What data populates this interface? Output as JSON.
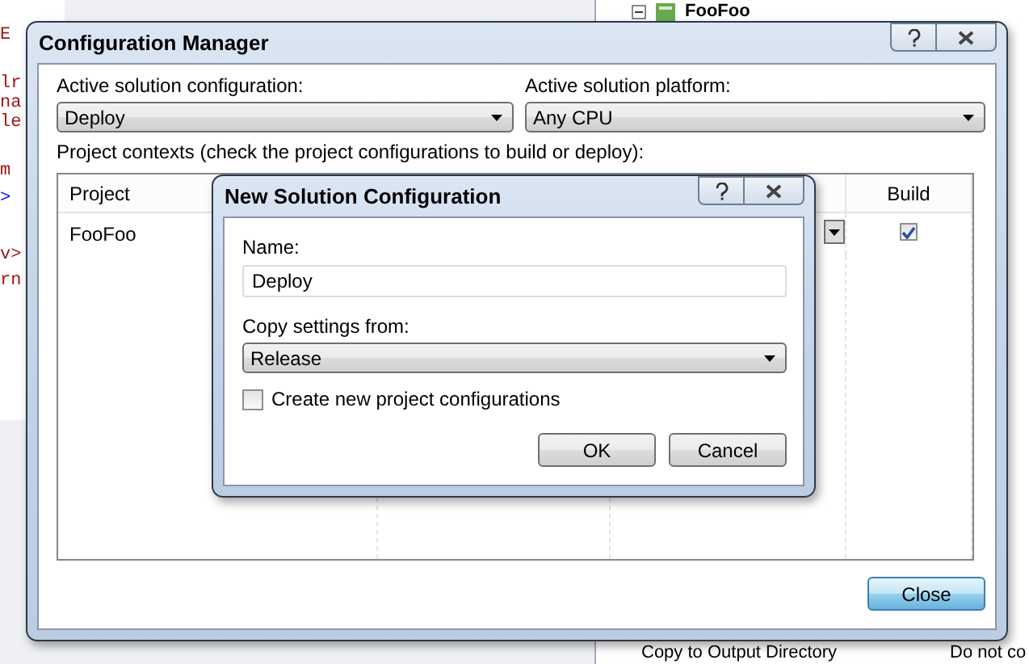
{
  "background": {
    "code_lines": [
      {
        "text": "E",
        "color": "#a31515"
      },
      {
        "text": "lr",
        "color": "#a31515"
      },
      {
        "text": "na",
        "color": "#a31515"
      },
      {
        "text": "le",
        "color": "#a31515"
      },
      {
        "text": "m",
        "color": "#a31515"
      },
      {
        "text": ">",
        "color": "#0000ff"
      },
      {
        "text": "v>",
        "color": "#a31515"
      },
      {
        "text": "rn",
        "color": "#a31515"
      }
    ],
    "tree_item": "FooFoo",
    "property": {
      "name": "Copy to Output Directory",
      "value": "Do not co"
    }
  },
  "config_manager": {
    "title": "Configuration Manager",
    "config_label": "Active solution configuration:",
    "config_value": "Deploy",
    "platform_label": "Active solution platform:",
    "platform_value": "Any CPU",
    "contexts_label": "Project contexts (check the project configurations to build or deploy):",
    "columns": [
      "Project",
      "Build"
    ],
    "rows": [
      {
        "project": "FooFoo",
        "build": true
      }
    ],
    "close_button": "Close"
  },
  "dialog": {
    "title": "New Solution Configuration",
    "name_label": "Name:",
    "name_value": "Deploy",
    "copy_label": "Copy settings from:",
    "copy_value": "Release",
    "create_label": "Create new project configurations",
    "create_checked": false,
    "buttons": [
      "OK",
      "Cancel"
    ]
  }
}
